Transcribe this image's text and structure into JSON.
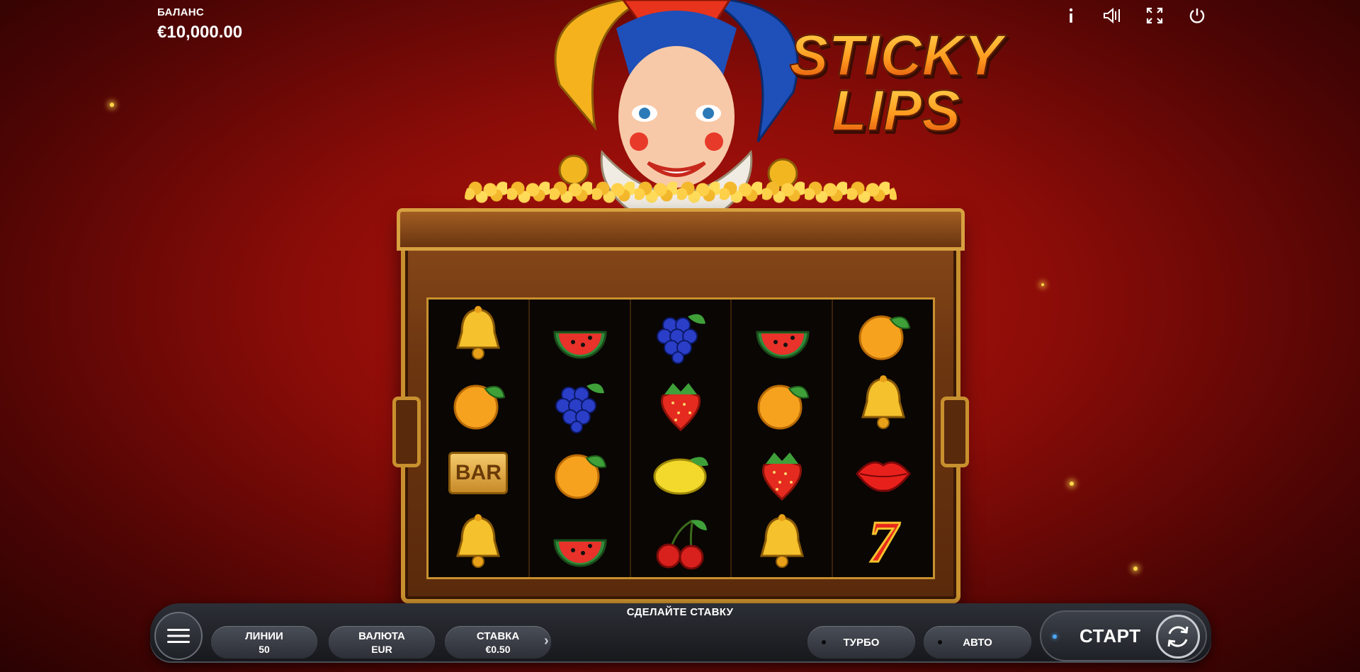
{
  "balance": {
    "label": "БАЛАНС",
    "value": "€10,000.00"
  },
  "top_icons": [
    "info-icon",
    "sound-icon",
    "fullscreen-icon",
    "power-icon"
  ],
  "logo": {
    "line1": "STICKY",
    "line2": "LIPS"
  },
  "reels": [
    [
      "bell",
      "orange",
      "bar",
      "bell"
    ],
    [
      "watermelon",
      "grapes",
      "orange",
      "watermelon"
    ],
    [
      "grapes",
      "strawberry",
      "lemon",
      "cherries"
    ],
    [
      "watermelon",
      "orange",
      "strawberry",
      "bell"
    ],
    [
      "orange",
      "bell",
      "lips",
      "seven"
    ]
  ],
  "bar_symbol_text": "BAR",
  "seven_symbol_text": "7",
  "controls": {
    "bet_message": "СДЕЛАЙТЕ СТАВКУ",
    "lines": {
      "label": "ЛИНИИ",
      "value": "50"
    },
    "currency": {
      "label": "ВАЛЮТА",
      "value": "EUR"
    },
    "bet": {
      "label": "СТАВКА",
      "value": "€0.50"
    },
    "turbo": "ТУРБО",
    "auto": "АВТО",
    "start": "СТАРТ"
  },
  "colors": {
    "background": "#8a0c08",
    "gold": "#c8902e",
    "start_indicator": "#4da8ff"
  }
}
